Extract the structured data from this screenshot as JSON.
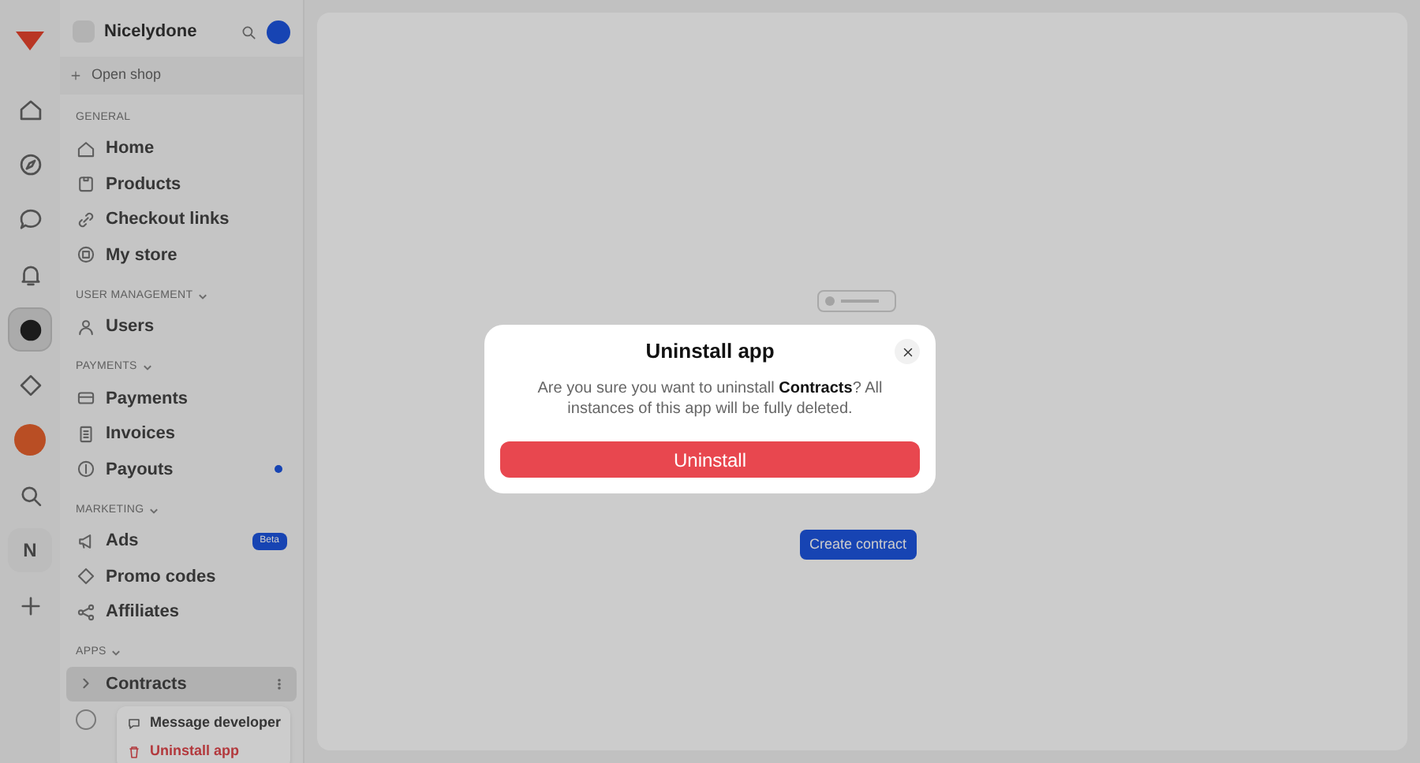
{
  "rail": {
    "items": [
      {
        "kind": "logo",
        "selected": false
      },
      {
        "kind": "home",
        "selected": false
      },
      {
        "kind": "compass",
        "selected": false
      },
      {
        "kind": "chat",
        "selected": false
      },
      {
        "kind": "bell",
        "selected": false
      },
      {
        "kind": "app",
        "selected": true
      },
      {
        "kind": "tag",
        "selected": false
      },
      {
        "kind": "avatar",
        "selected": false
      },
      {
        "kind": "search",
        "selected": false
      },
      {
        "kind": "letter",
        "label": "N",
        "selected": false
      },
      {
        "kind": "plus",
        "selected": false
      }
    ]
  },
  "sidebar": {
    "workspace": "Nicelydone",
    "open_shop": "Open shop",
    "sections": [
      {
        "title": "GENERAL",
        "collapsible": false,
        "items": [
          {
            "label": "Home",
            "selected": false
          },
          {
            "label": "Products",
            "selected": false
          },
          {
            "label": "Checkout links",
            "selected": false
          },
          {
            "label": "My store",
            "selected": false
          }
        ]
      },
      {
        "title": "USER MANAGEMENT",
        "collapsible": true,
        "items": [
          {
            "label": "Users",
            "selected": false
          }
        ]
      },
      {
        "title": "PAYMENTS",
        "collapsible": true,
        "items": [
          {
            "label": "Payments",
            "selected": false
          },
          {
            "label": "Invoices",
            "selected": false
          },
          {
            "label": "Payouts",
            "selected": false,
            "dot": true
          }
        ]
      },
      {
        "title": "MARKETING",
        "collapsible": true,
        "items": [
          {
            "label": "Ads",
            "selected": false,
            "badge": "Beta"
          },
          {
            "label": "Promo codes",
            "selected": false
          },
          {
            "label": "Affiliates",
            "selected": false
          }
        ]
      },
      {
        "title": "APPS",
        "collapsible": true,
        "items": [
          {
            "label": "Contracts",
            "selected": true
          }
        ]
      }
    ],
    "context_menu": [
      {
        "label": "Message developer",
        "kind": "normal"
      },
      {
        "label": "Uninstall app",
        "kind": "danger"
      }
    ]
  },
  "main": {
    "primary_button": "Create contract"
  },
  "modal": {
    "title": "Uninstall app",
    "message": "Are you sure you want to uninstall **Contracts**? All instances of this app will be fully deleted.",
    "confirm_button": "Uninstall"
  }
}
